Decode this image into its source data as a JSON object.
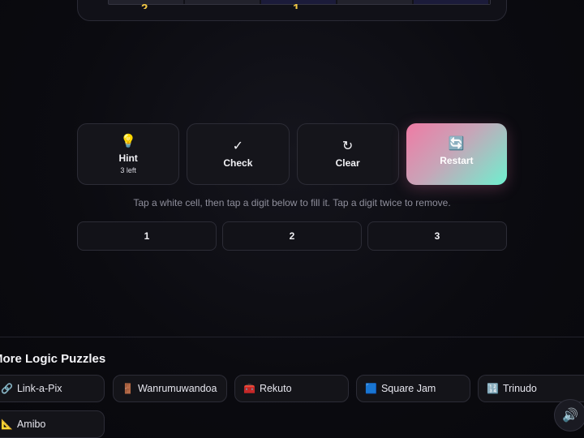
{
  "board": {
    "visible_digits": [
      "2",
      "1"
    ]
  },
  "controls": {
    "hint": {
      "icon": "💡",
      "label": "Hint",
      "sub": "3 left"
    },
    "check": {
      "icon": "✓",
      "label": "Check"
    },
    "clear": {
      "icon": "↻",
      "label": "Clear"
    },
    "restart": {
      "icon": "🔄",
      "label": "Restart"
    }
  },
  "instructions": "Tap a white cell, then tap a digit below to fill it. Tap a digit twice to remove.",
  "digit_pad": [
    "1",
    "2",
    "3"
  ],
  "more": {
    "title": "More Logic Puzzles",
    "puzzles": [
      {
        "icon": "🔗",
        "label": "Link-a-Pix"
      },
      {
        "icon": "🚪",
        "label": "Wanrumuwandoa"
      },
      {
        "icon": "🧰",
        "label": "Rekuto"
      },
      {
        "icon": "🟦",
        "label": "Square Jam"
      },
      {
        "icon": "🔢",
        "label": "Trinudo"
      },
      {
        "icon": "📐",
        "label": "Amibo"
      }
    ]
  },
  "sound_icon": "🔊",
  "colors": {
    "accent_gradient_start": "#f07aa4",
    "accent_gradient_end": "#6ef0cf",
    "board_digit": "#f2c744"
  }
}
